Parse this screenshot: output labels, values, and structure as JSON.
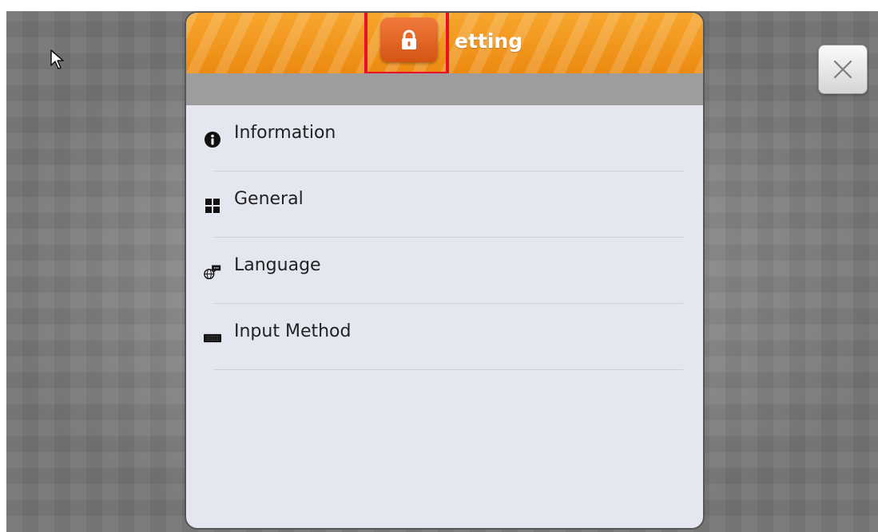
{
  "dialog": {
    "title": "etting",
    "lock_icon": "lock-icon",
    "close_icon": "close-icon"
  },
  "menu": {
    "items": [
      {
        "label": "Information",
        "icon": "info-icon"
      },
      {
        "label": "General",
        "icon": "grid-icon"
      },
      {
        "label": "Language",
        "icon": "globe-chat-icon"
      },
      {
        "label": "Input Method",
        "icon": "keyboard-icon"
      }
    ]
  },
  "colors": {
    "header_orange": "#ec8a10",
    "lock_button": "#e0601f",
    "highlight_red": "#e8102a",
    "panel_background": "#e5e7f0"
  }
}
